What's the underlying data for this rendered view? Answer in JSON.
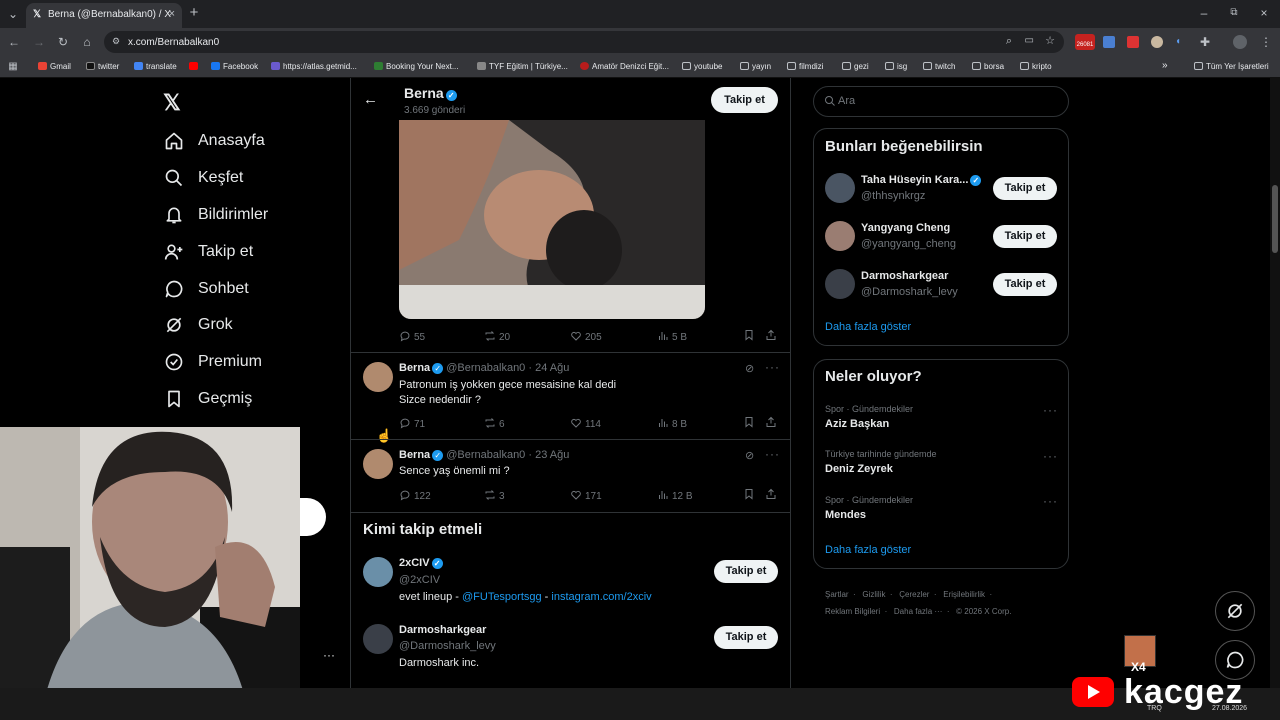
{
  "browser": {
    "tab_title": "Berna (@Bernabalkan0) / X",
    "url": "x.com/Bernabalkan0",
    "ext_badge": "26081",
    "bookmarks": [
      "Gmail",
      "twitter",
      "translate",
      "Facebook",
      "https://atlas.getmid...",
      "Booking Your Next...",
      "TYF Eğitim | Türkiye...",
      "Amatör Denizci Eğit...",
      "youtube",
      "yayın",
      "filmdizi",
      "gezi",
      "isg",
      "twitch",
      "borsa",
      "kripto"
    ],
    "all_bookmarks": "Tüm Yer İşaretleri"
  },
  "sidebar": {
    "items": [
      {
        "label": "Anasayfa",
        "icon": "home-icon"
      },
      {
        "label": "Keşfet",
        "icon": "search-icon"
      },
      {
        "label": "Bildirimler",
        "icon": "bell-icon"
      },
      {
        "label": "Takip et",
        "icon": "person-add-icon"
      },
      {
        "label": "Sohbet",
        "icon": "chat-icon"
      },
      {
        "label": "Grok",
        "icon": "grok-icon"
      },
      {
        "label": "Premium",
        "icon": "premium-icon"
      },
      {
        "label": "Geçmiş",
        "icon": "bookmark-icon"
      }
    ],
    "more": "···"
  },
  "header": {
    "name": "Berna",
    "posts": "3.669 gönderi",
    "follow": "Takip et"
  },
  "post1": {
    "replies": "55",
    "reposts": "20",
    "likes": "205",
    "views": "5 B"
  },
  "post2": {
    "name": "Berna",
    "handle": "@Bernabalkan0",
    "date": "· 24 Ağu",
    "line1": "Patronum iş yokken gece mesaisine kal dedi",
    "line2": "Sizce nedendir ?",
    "replies": "71",
    "reposts": "6",
    "likes": "114",
    "views": "8 B"
  },
  "post3": {
    "name": "Berna",
    "handle": "@Bernabalkan0",
    "date": "· 23 Ağu",
    "line1": "Sence yaş önemli mi ?",
    "replies": "122",
    "reposts": "3",
    "likes": "171",
    "views": "12 B"
  },
  "who_to_follow": {
    "title": "Kimi takip etmeli",
    "users": [
      {
        "name": "2xCIV",
        "handle": "@2xCIV",
        "bio_prefix": "evet lineup - ",
        "bio_link1": "@FUTesportsgg",
        "bio_sep": " - ",
        "bio_link2": "instagram.com/2xciv",
        "follow": "Takip et"
      },
      {
        "name": "Darmosharkgear",
        "handle": "@Darmoshark_levy",
        "bio": "Darmoshark inc.",
        "follow": "Takip et"
      }
    ]
  },
  "search": {
    "placeholder": "Ara"
  },
  "suggest": {
    "title": "Bunları beğenebilirsin",
    "users": [
      {
        "name": "Taha Hüseyin Kara...",
        "handle": "@thhsynkrgz",
        "follow": "Takip et"
      },
      {
        "name": "Yangyang Cheng",
        "handle": "@yangyang_cheng",
        "follow": "Takip et"
      },
      {
        "name": "Darmosharkgear",
        "handle": "@Darmoshark_levy",
        "follow": "Takip et"
      }
    ],
    "more": "Daha fazla göster"
  },
  "trends": {
    "title": "Neler oluyor?",
    "items": [
      {
        "meta": "Spor · Gündemdekiler",
        "name": "Aziz Başkan"
      },
      {
        "meta": "Türkiye tarihinde gündemde",
        "name": "Deniz Zeyrek"
      },
      {
        "meta": "Spor · Gündemdekiler",
        "name": "Mendes"
      }
    ],
    "more": "Daha fazla göster"
  },
  "footer": {
    "links": [
      "Şartlar",
      "Gizlilik",
      "Çerezler",
      "Erişilebilirlik",
      "Reklam Bilgileri",
      "Daha fazla ···",
      "© 2026 X Corp."
    ]
  },
  "overlay": {
    "brand": "kacgez",
    "badge": "X4",
    "tray_lang": "TRQ",
    "tray_time": "27.08.2026"
  },
  "colors": {
    "accent": "#1d9bf0",
    "bg": "#000000",
    "border": "#2f3336",
    "muted": "#71767b"
  }
}
